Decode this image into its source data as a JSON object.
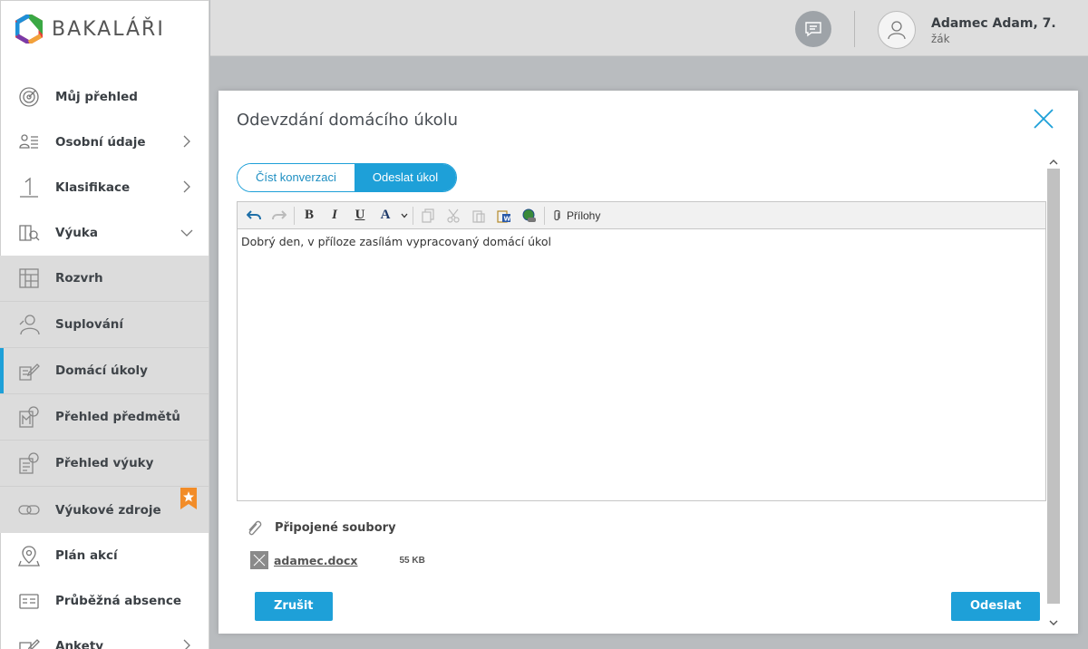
{
  "brand": {
    "name": "BAKALÁŘI"
  },
  "header": {
    "user_name": "Adamec Adam, 7.",
    "user_role": "žák"
  },
  "sidebar": {
    "items": [
      {
        "label": "Můj přehled",
        "icon": "target-icon"
      },
      {
        "label": "Osobní údaje",
        "icon": "person-list-icon"
      },
      {
        "label": "Klasifikace",
        "icon": "grade-one-icon"
      },
      {
        "label": "Výuka",
        "icon": "book-search-icon"
      }
    ],
    "sub_items": [
      {
        "label": "Rozvrh",
        "icon": "timetable-icon"
      },
      {
        "label": "Suplování",
        "icon": "substitution-icon"
      },
      {
        "label": "Domácí úkoly",
        "icon": "homework-icon"
      },
      {
        "label": "Přehled předmětů",
        "icon": "subjects-icon"
      },
      {
        "label": "Přehled výuky",
        "icon": "lessons-icon"
      },
      {
        "label": "Výukové zdroje",
        "icon": "link-icon"
      }
    ],
    "after_items": [
      {
        "label": "Plán akcí",
        "icon": "map-pin-icon"
      },
      {
        "label": "Průběžná absence",
        "icon": "id-card-icon"
      },
      {
        "label": "Ankety",
        "icon": "pencil-icon"
      }
    ]
  },
  "modal": {
    "title": "Odevzdání domácího úkolu",
    "tabs": [
      "Číst konverzaci",
      "Odeslat úkol"
    ],
    "toolbar": {
      "attachments_label": "Přílohy"
    },
    "editor_text": "Dobrý den, v příloze zasílám vypracovaný domácí úkol",
    "files_header": "Připojené soubory",
    "file": {
      "name": "adamec.docx",
      "size": "55 KB"
    },
    "cancel_label": "Zrušit",
    "send_label": "Odeslat"
  },
  "colors": {
    "accent": "#1ea0d8",
    "badge": "#f28c28"
  }
}
